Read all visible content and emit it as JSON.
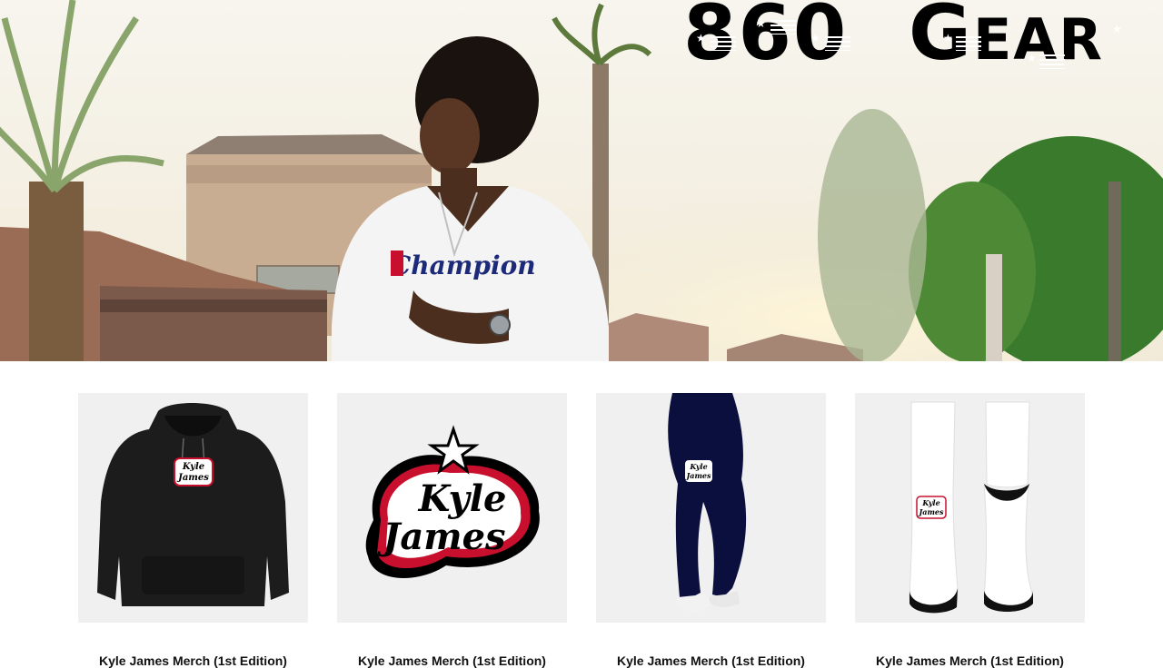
{
  "header": {
    "brand_word1": "860",
    "brand_word2_initial": "G",
    "brand_word2_rest": "EAR"
  },
  "hero": {
    "shirt_text": "Champion"
  },
  "products": [
    {
      "title": "Kyle James Merch (1st Edition)",
      "item": "hoodie",
      "logo_line1": "Kyle",
      "logo_line2": "James"
    },
    {
      "title": "Kyle James Merch (1st Edition)",
      "item": "sticker",
      "logo_line1": "Kyle",
      "logo_line2": "James"
    },
    {
      "title": "Kyle James Merch (1st Edition)",
      "item": "leggings",
      "logo_line1": "Kyle",
      "logo_line2": "James"
    },
    {
      "title": "Kyle James Merch (1st Edition)",
      "item": "socks",
      "logo_line1": "Kyle",
      "logo_line2": "James"
    }
  ],
  "colors": {
    "logo_red": "#c8102e",
    "navy": "#0b0f3d",
    "sky": "#f3efe4"
  }
}
